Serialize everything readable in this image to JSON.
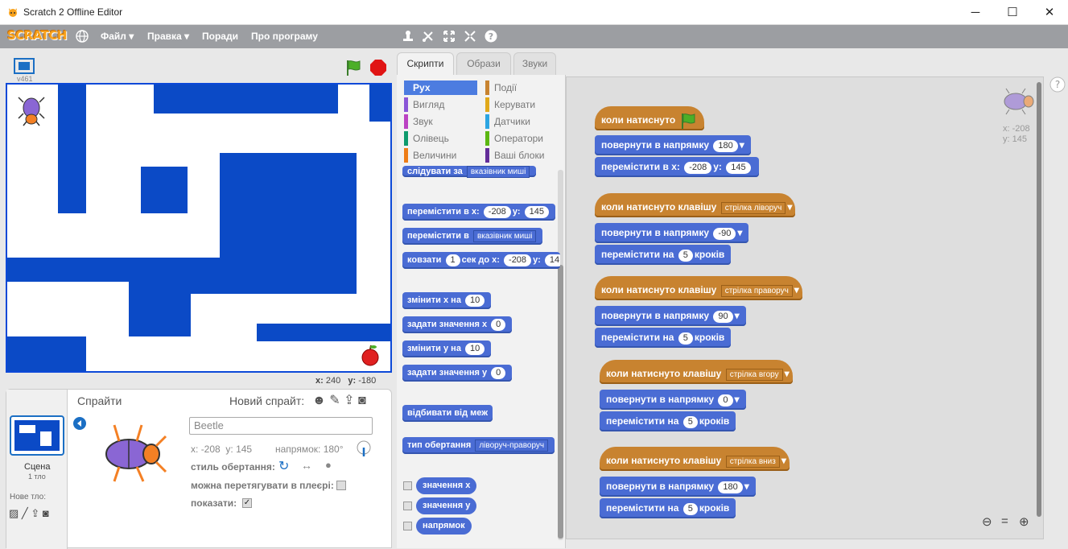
{
  "window": {
    "title": "Scratch 2 Offline Editor",
    "minimize": "─",
    "maximize": "☐",
    "close": "✕"
  },
  "menubar": {
    "logo": "SCRATCH",
    "items": [
      "Файл",
      "Правка",
      "Поради",
      "Про програму"
    ]
  },
  "stage": {
    "version": "v461",
    "coords_x_label": "x:",
    "coords_x": "240",
    "coords_y_label": "y:",
    "coords_y": "-180"
  },
  "sprites": {
    "header": "Спрайти",
    "new_sprite": "Новий спрайт:",
    "stage_label": "Сцена",
    "stage_sub": "1 тло",
    "new_backdrop": "Нове тло:",
    "name_value": "Beetle",
    "x_label": "x:",
    "x": "-208",
    "y_label": "y:",
    "y": "145",
    "dir_label": "напрямок:",
    "dir": "180°",
    "rotation_label": "стиль обертання:",
    "drag_label": "можна перетягувати в плеєрі:",
    "show_label": "показати:"
  },
  "tabs": [
    "Скрипти",
    "Образи",
    "Звуки"
  ],
  "categories": {
    "left": [
      "Рух",
      "Вигляд",
      "Звук",
      "Олівець",
      "Величини"
    ],
    "right": [
      "Події",
      "Керувати",
      "Датчики",
      "Оператори",
      "Ваші блоки"
    ]
  },
  "palette": {
    "b0": "слідувати за",
    "b0dd": "вказівник миші",
    "b1": "перемістити в x:",
    "b1x": "-208",
    "b1y_label": "y:",
    "b1y": "145",
    "b2": "перемістити в",
    "b2dd": "вказівник миші",
    "b3": "ковзати",
    "b3n": "1",
    "b3mid": "сек до x:",
    "b3x": "-208",
    "b3y_label": "y:",
    "b3y": "14",
    "b4": "змінити х на",
    "b4n": "10",
    "b5": "задати значення х",
    "b5n": "0",
    "b6": "змінити у на",
    "b6n": "10",
    "b7": "задати значення у",
    "b7n": "0",
    "b8": "відбивати від меж",
    "b9": "тип обертання",
    "b9dd": "ліворуч-праворуч",
    "r1": "значення х",
    "r2": "значення у",
    "r3": "напрямок"
  },
  "scripts": {
    "s1": {
      "hat": "коли натиснуто",
      "b1": "повернути в напрямку",
      "b1v": "180",
      "b2": "перемістити в x:",
      "b2x": "-208",
      "b2yl": "y:",
      "b2y": "145"
    },
    "s2": {
      "hat": "коли натиснуто клавішу",
      "key": "стрілка ліворуч",
      "b1": "повернути в напрямку",
      "b1v": "-90",
      "b2a": "перемістити на",
      "b2v": "5",
      "b2b": "кроків"
    },
    "s3": {
      "hat": "коли натиснуто клавішу",
      "key": "стрілка праворуч",
      "b1": "повернути в напрямку",
      "b1v": "90",
      "b2a": "перемістити на",
      "b2v": "5",
      "b2b": "кроків"
    },
    "s4": {
      "hat": "коли натиснуто клавішу",
      "key": "стрілка вгору",
      "b1": "повернути в напрямку",
      "b1v": "0",
      "b2a": "перемістити на",
      "b2v": "5",
      "b2b": "кроків"
    },
    "s5": {
      "hat": "коли натиснуто клавішу",
      "key": "стрілка вниз",
      "b1": "повернути в напрямку",
      "b1v": "180",
      "b2a": "перемістити на",
      "b2v": "5",
      "b2b": "кроків"
    },
    "corner_x": "x: -208",
    "corner_y": "y: 145"
  },
  "colors": {
    "motion": "#4a6cd4",
    "events": "#c88330",
    "stage_blue": "#0b4ac6"
  }
}
